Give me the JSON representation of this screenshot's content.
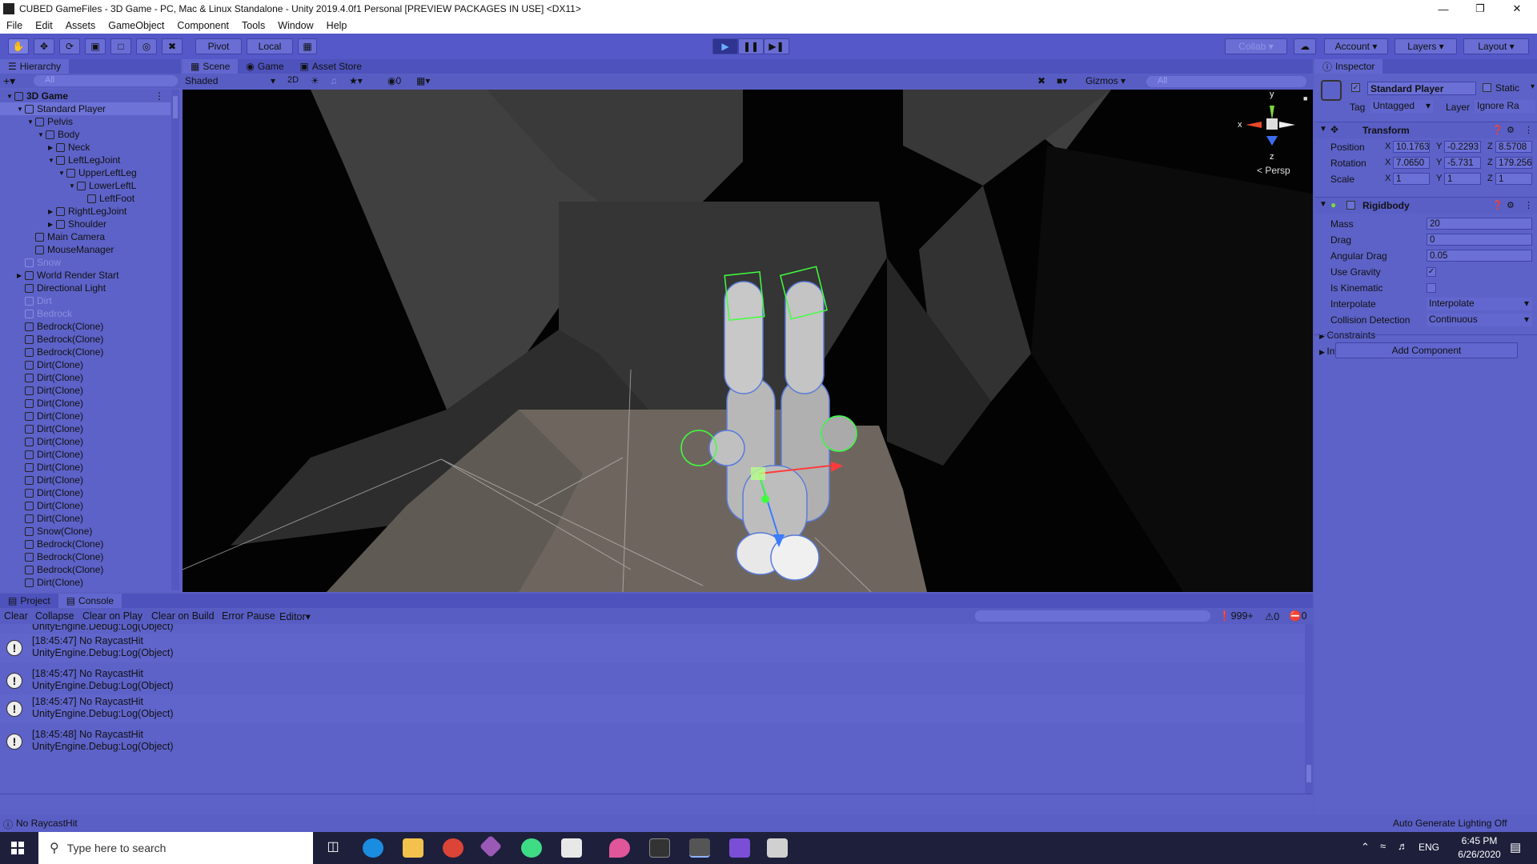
{
  "window": {
    "title": "CUBED GameFiles - 3D Game - PC, Mac & Linux Standalone - Unity 2019.4.0f1 Personal [PREVIEW PACKAGES IN USE] <DX11>"
  },
  "menu": [
    "File",
    "Edit",
    "Assets",
    "GameObject",
    "Component",
    "Tools",
    "Window",
    "Help"
  ],
  "toolbar": {
    "pivot": "Pivot",
    "local": "Local",
    "collab": "Collab",
    "account": "Account",
    "layers": "Layers",
    "layout": "Layout"
  },
  "hierarchy": {
    "tab": "Hierarchy",
    "search_placeholder": "All",
    "items": [
      {
        "label": "3D Game",
        "depth": 0,
        "scene": true
      },
      {
        "label": "Standard Player",
        "depth": 1,
        "selected": true
      },
      {
        "label": "Pelvis",
        "depth": 2
      },
      {
        "label": "Body",
        "depth": 3
      },
      {
        "label": "Neck",
        "depth": 4
      },
      {
        "label": "LeftLegJoint",
        "depth": 4
      },
      {
        "label": "UpperLeftLeg",
        "depth": 5
      },
      {
        "label": "LowerLeftL",
        "depth": 6
      },
      {
        "label": "LeftFoot",
        "depth": 7
      },
      {
        "label": "RightLegJoint",
        "depth": 4
      },
      {
        "label": "Shoulder",
        "depth": 4
      },
      {
        "label": "Main Camera",
        "depth": 2
      },
      {
        "label": "MouseManager",
        "depth": 2
      },
      {
        "label": "Snow",
        "depth": 1,
        "dim": true
      },
      {
        "label": "World Render Start",
        "depth": 1
      },
      {
        "label": "Directional Light",
        "depth": 1
      },
      {
        "label": "Dirt",
        "depth": 1,
        "dim": true
      },
      {
        "label": "Bedrock",
        "depth": 1,
        "dim": true
      },
      {
        "label": "Bedrock(Clone)",
        "depth": 1
      },
      {
        "label": "Bedrock(Clone)",
        "depth": 1
      },
      {
        "label": "Bedrock(Clone)",
        "depth": 1
      },
      {
        "label": "Dirt(Clone)",
        "depth": 1
      },
      {
        "label": "Dirt(Clone)",
        "depth": 1
      },
      {
        "label": "Dirt(Clone)",
        "depth": 1
      },
      {
        "label": "Dirt(Clone)",
        "depth": 1
      },
      {
        "label": "Dirt(Clone)",
        "depth": 1
      },
      {
        "label": "Dirt(Clone)",
        "depth": 1
      },
      {
        "label": "Dirt(Clone)",
        "depth": 1
      },
      {
        "label": "Dirt(Clone)",
        "depth": 1
      },
      {
        "label": "Dirt(Clone)",
        "depth": 1
      },
      {
        "label": "Dirt(Clone)",
        "depth": 1
      },
      {
        "label": "Dirt(Clone)",
        "depth": 1
      },
      {
        "label": "Dirt(Clone)",
        "depth": 1
      },
      {
        "label": "Dirt(Clone)",
        "depth": 1
      },
      {
        "label": "Snow(Clone)",
        "depth": 1
      },
      {
        "label": "Bedrock(Clone)",
        "depth": 1
      },
      {
        "label": "Bedrock(Clone)",
        "depth": 1
      },
      {
        "label": "Bedrock(Clone)",
        "depth": 1
      },
      {
        "label": "Dirt(Clone)",
        "depth": 1
      }
    ]
  },
  "scene_tabs": [
    "Scene",
    "Game",
    "Asset Store"
  ],
  "scene_toolbar": {
    "shading": "Shaded",
    "mode2d": "2D",
    "hidden_count": "0",
    "gizmos": "Gizmos",
    "search_placeholder": "All"
  },
  "gizmo": {
    "x": "x",
    "y": "y",
    "z": "z",
    "persp": "< Persp"
  },
  "inspector": {
    "tab": "Inspector",
    "object_name": "Standard Player",
    "static": "Static",
    "tag_label": "Tag",
    "tag": "Untagged",
    "layer_label": "Layer",
    "layer": "Ignore Ra",
    "transform": {
      "title": "Transform",
      "position": {
        "label": "Position",
        "x": "10.1763",
        "y": "-0.2293",
        "z": "8.5708"
      },
      "rotation": {
        "label": "Rotation",
        "x": "7.0650",
        "y": "-5.731",
        "z": "179.256"
      },
      "scale": {
        "label": "Scale",
        "x": "1",
        "y": "1",
        "z": "1"
      }
    },
    "rigidbody": {
      "title": "Rigidbody",
      "mass": {
        "label": "Mass",
        "value": "20"
      },
      "drag": {
        "label": "Drag",
        "value": "0"
      },
      "angular_drag": {
        "label": "Angular Drag",
        "value": "0.05"
      },
      "use_gravity": {
        "label": "Use Gravity",
        "checked": true
      },
      "is_kinematic": {
        "label": "Is Kinematic",
        "checked": false
      },
      "interpolate": {
        "label": "Interpolate",
        "value": "Interpolate"
      },
      "collision": {
        "label": "Collision Detection",
        "value": "Continuous"
      },
      "constraints": "Constraints",
      "info": "Info"
    },
    "add_component": "Add Component"
  },
  "console": {
    "tabs": [
      "Project",
      "Console"
    ],
    "buttons": [
      "Clear",
      "Collapse",
      "Clear on Play",
      "Clear on Build",
      "Error Pause",
      "Editor"
    ],
    "counts": {
      "log": "999+",
      "warn": "0",
      "error": "0"
    },
    "partial_line": "UnityEngine.Debug:Log(Object)",
    "entries": [
      {
        "line1": "[18:45:47] No RaycastHit",
        "line2": "UnityEngine.Debug:Log(Object)"
      },
      {
        "line1": "[18:45:47] No RaycastHit",
        "line2": "UnityEngine.Debug:Log(Object)"
      },
      {
        "line1": "[18:45:47] No RaycastHit",
        "line2": "UnityEngine.Debug:Log(Object)"
      },
      {
        "line1": "[18:45:48] No RaycastHit",
        "line2": "UnityEngine.Debug:Log(Object)"
      }
    ]
  },
  "statusbar": {
    "message": "No RaycastHit",
    "lighting": "Auto Generate Lighting Off"
  },
  "taskbar": {
    "search_placeholder": "Type here to search",
    "lang": "ENG",
    "time": "6:45 PM",
    "date": "6/26/2020"
  }
}
